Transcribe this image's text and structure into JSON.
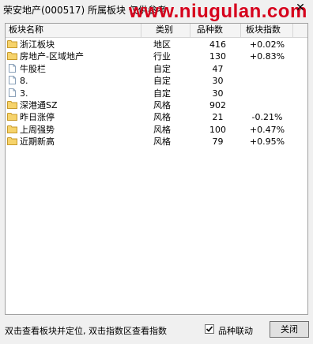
{
  "window": {
    "title": "荣安地产(000517)  所属板块 仅供参考",
    "watermark": "www.niugulan.com",
    "close_glyph": "✕"
  },
  "table": {
    "columns": [
      "板块名称",
      "类别",
      "品种数",
      "板块指数"
    ],
    "rows": [
      {
        "icon": "folder",
        "name": "浙江板块",
        "type": "地区",
        "count": "416",
        "index": "+0.02%"
      },
      {
        "icon": "folder",
        "name": "房地产-区域地产",
        "type": "行业",
        "count": "130",
        "index": "+0.83%"
      },
      {
        "icon": "doc",
        "name": "牛股栏",
        "type": "自定",
        "count": "47",
        "index": ""
      },
      {
        "icon": "doc",
        "name": "8.",
        "type": "自定",
        "count": "30",
        "index": ""
      },
      {
        "icon": "doc",
        "name": "3.",
        "type": "自定",
        "count": "30",
        "index": ""
      },
      {
        "icon": "folder",
        "name": "深港通SZ",
        "type": "风格",
        "count": "902",
        "index": ""
      },
      {
        "icon": "folder",
        "name": "昨日涨停",
        "type": "风格",
        "count": "21",
        "index": "-0.21%"
      },
      {
        "icon": "folder",
        "name": "上周强势",
        "type": "风格",
        "count": "100",
        "index": "+0.47%"
      },
      {
        "icon": "folder",
        "name": "近期新高",
        "type": "风格",
        "count": "79",
        "index": "+0.95%"
      }
    ]
  },
  "footer": {
    "hint": "双击查看板块并定位, 双击指数区查看指数",
    "checkbox_label": "品种联动",
    "checkbox_checked": true,
    "close_button": "关闭"
  }
}
